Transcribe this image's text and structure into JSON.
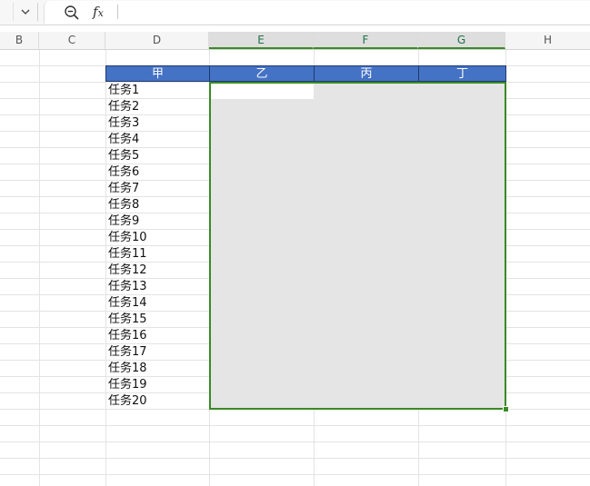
{
  "formula_bar": {
    "formula": ""
  },
  "columns": [
    {
      "letter": "B",
      "selected": false
    },
    {
      "letter": "C",
      "selected": false
    },
    {
      "letter": "D",
      "selected": false
    },
    {
      "letter": "E",
      "selected": true
    },
    {
      "letter": "F",
      "selected": true
    },
    {
      "letter": "G",
      "selected": true
    },
    {
      "letter": "H",
      "selected": false
    }
  ],
  "table": {
    "headers": [
      "甲",
      "乙",
      "丙",
      "丁"
    ],
    "tasks": [
      "任务1",
      "任务2",
      "任务3",
      "任务4",
      "任务5",
      "任务6",
      "任务7",
      "任务8",
      "任务9",
      "任务10",
      "任务11",
      "任务12",
      "任务13",
      "任务14",
      "任务15",
      "任务16",
      "任务17",
      "任务18",
      "任务19",
      "任务20"
    ]
  },
  "colors": {
    "header_fill": "#4472c4",
    "selection_border": "#3a8a24",
    "selection_fill": "#e5e5e5"
  }
}
